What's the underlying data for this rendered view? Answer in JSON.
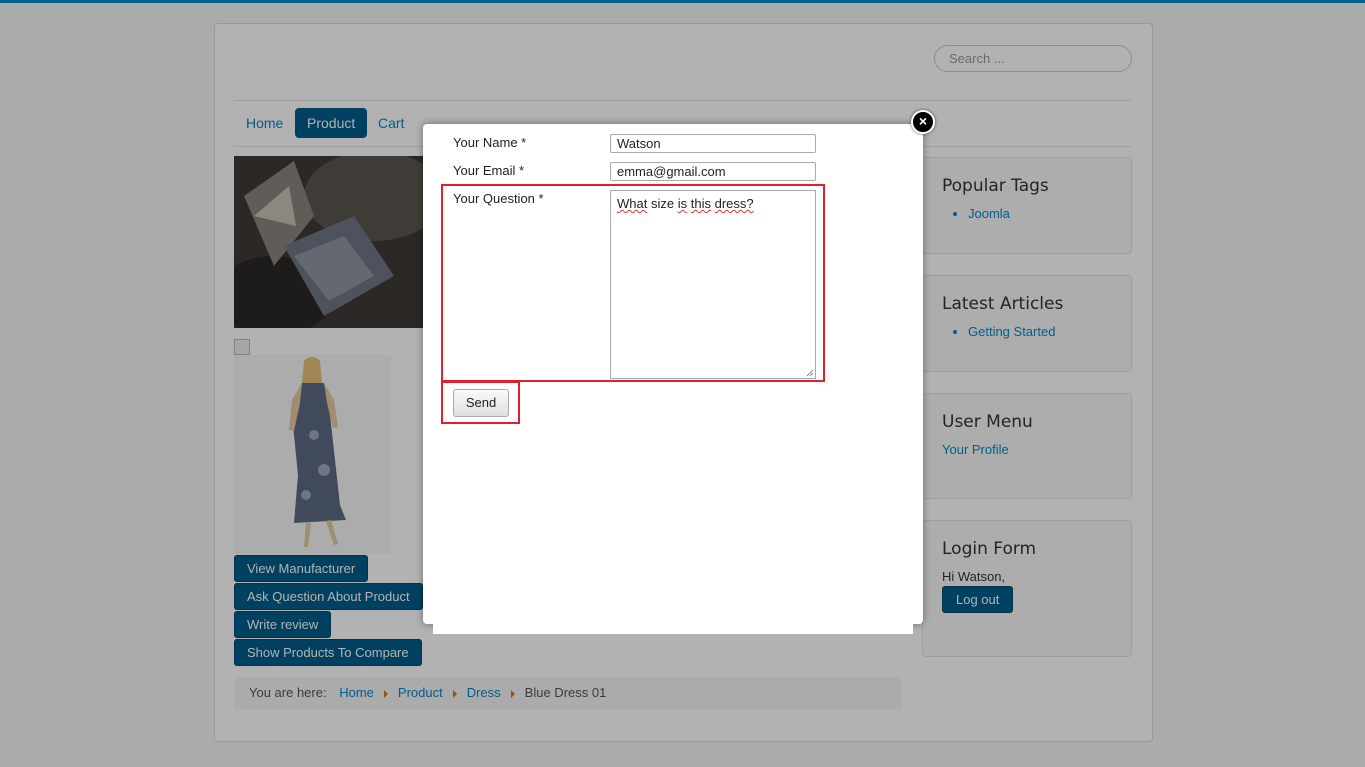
{
  "search": {
    "placeholder": "Search ..."
  },
  "nav": {
    "items": [
      {
        "label": "Home"
      },
      {
        "label": "Product"
      },
      {
        "label": "Cart"
      }
    ]
  },
  "product_actions": {
    "view_manufacturer": "View Manufacturer",
    "ask_question": "Ask Question About Product",
    "write_review": "Write review",
    "show_compare": "Show Products To Compare"
  },
  "breadcrumbs": {
    "prefix": "You are here:",
    "items": [
      "Home",
      "Product",
      "Dress"
    ],
    "current": "Blue Dress 01"
  },
  "sidebar": {
    "popular_tags": {
      "title": "Popular Tags",
      "items": [
        "Joomla"
      ]
    },
    "latest_articles": {
      "title": "Latest Articles",
      "items": [
        "Getting Started"
      ]
    },
    "user_menu": {
      "title": "User Menu",
      "link": "Your Profile"
    },
    "login_form": {
      "title": "Login Form",
      "greeting": "Hi Watson,",
      "logout_label": "Log out"
    }
  },
  "modal": {
    "name_label": "Your Name *",
    "name_value": "Watson",
    "email_label": "Your Email *",
    "email_value": "emma@gmail.com",
    "question_label": "Your Question *",
    "question_words": [
      "What",
      "size",
      "is",
      "this",
      "dress?"
    ],
    "send_label": "Send",
    "close_symbol": "×"
  },
  "colors": {
    "accent": "#005e8d",
    "link": "#0088cc",
    "highlight": "#e1202a"
  }
}
